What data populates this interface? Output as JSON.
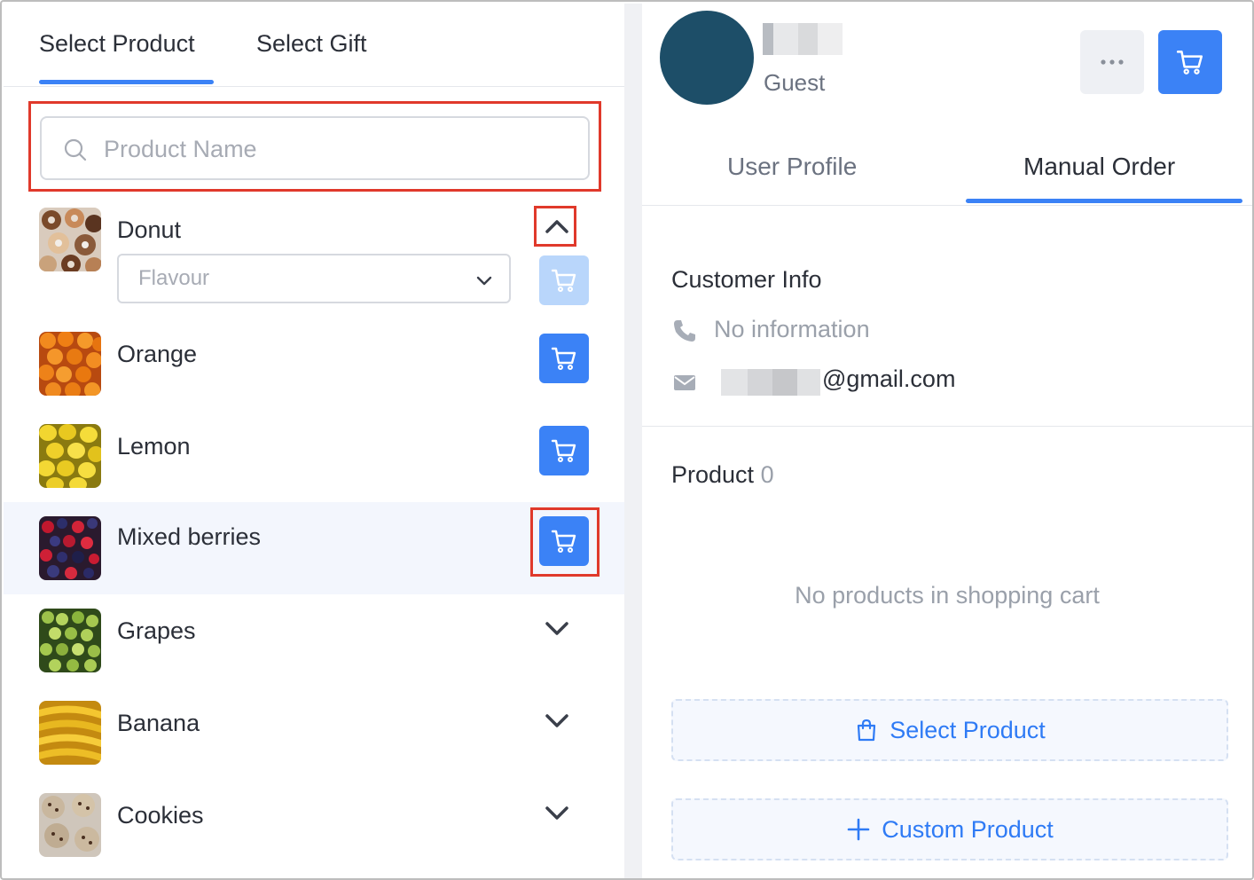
{
  "left_tabs": {
    "select_product": "Select Product",
    "select_gift": "Select Gift"
  },
  "search": {
    "placeholder": "Product Name"
  },
  "products": [
    {
      "name": "Donut",
      "expanded": true,
      "flavour_placeholder": "Flavour"
    },
    {
      "name": "Orange"
    },
    {
      "name": "Lemon"
    },
    {
      "name": "Mixed berries"
    },
    {
      "name": "Grapes"
    },
    {
      "name": "Banana"
    },
    {
      "name": "Cookies"
    }
  ],
  "profile": {
    "status": "Guest"
  },
  "right_tabs": {
    "user_profile": "User Profile",
    "manual_order": "Manual Order"
  },
  "customer_info": {
    "title": "Customer Info",
    "phone": "No information",
    "email_domain": "@gmail.com"
  },
  "product_section": {
    "title": "Product",
    "count": "0",
    "empty_message": "No products in shopping cart"
  },
  "actions": {
    "select_product": "Select Product",
    "custom_product": "Custom Product"
  },
  "colors": {
    "accent": "#3b82f6",
    "highlight_border": "#e0392b",
    "avatar": "#1d4e68"
  }
}
